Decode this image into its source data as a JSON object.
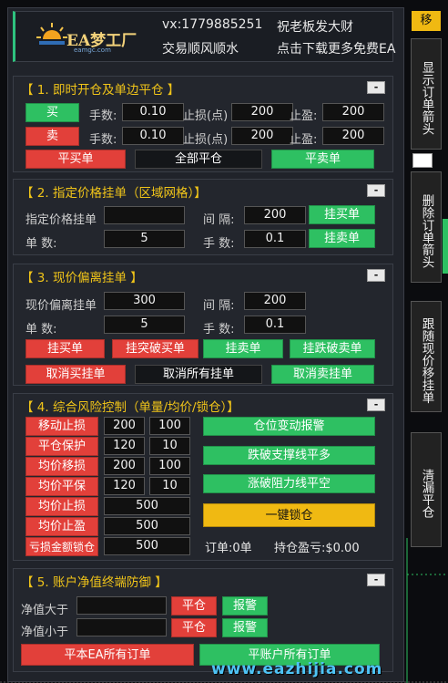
{
  "header": {
    "logo_text": "EA梦工厂",
    "logo_sub": "eamgc.com",
    "contact": "vx:1779885251",
    "wish1": "祝老板发大财",
    "wish2": "交易顺风顺水",
    "download": "点击下载更多免费EA"
  },
  "side": {
    "move": "移",
    "show_arrows": "显示订单箭头",
    "delete_arrows": "删除订单箭头",
    "trailing": "跟随现价移挂单",
    "clear": "清漏平仓"
  },
  "s1": {
    "title": "【 1. 即时开仓及单边平仓 】",
    "collapse": "-",
    "buy": "买",
    "sell": "卖",
    "lots_label": "手数:",
    "sl_label": "止损(点)",
    "tp_label": "止盈:",
    "buy_lots": "0.10",
    "buy_sl": "200",
    "buy_tp": "200",
    "sell_lots": "0.10",
    "sell_sl": "200",
    "sell_tp": "200",
    "close_buy": "平买单",
    "close_all": "全部平仓",
    "close_sell": "平卖单"
  },
  "s2": {
    "title": "【 2. 指定价格挂单（区域网格）】",
    "collapse": "-",
    "price_label": "指定价格挂单",
    "price_value": "",
    "interval_label": "间 隔:",
    "interval_value": "200",
    "count_label": "单    数:",
    "count_value": "5",
    "lots_label": "手 数:",
    "lots_value": "0.1",
    "buy_limit": "挂买单",
    "sell_limit": "挂卖单"
  },
  "s3": {
    "title": "【 3. 现价偏离挂单 】",
    "collapse": "-",
    "offset_label": "现价偏离挂单",
    "offset_value": "300",
    "interval_label": "间 隔:",
    "interval_value": "200",
    "count_label": "单    数:",
    "count_value": "5",
    "lots_label": "手 数:",
    "lots_value": "0.1",
    "buy_limit": "挂买单",
    "buy_stop": "挂突破买单",
    "sell_limit": "挂卖单",
    "sell_stop": "挂跌破卖单",
    "cancel_buy": "取消买挂单",
    "cancel_all": "取消所有挂单",
    "cancel_sell": "取消卖挂单"
  },
  "s4": {
    "title": "【 4. 综合风险控制（单量/均价/锁仓）】",
    "collapse": "-",
    "rows": [
      {
        "label": "移动止损",
        "v1": "200",
        "v2": "100"
      },
      {
        "label": "平仓保护",
        "v1": "120",
        "v2": "10"
      },
      {
        "label": "均价移损",
        "v1": "200",
        "v2": "100"
      },
      {
        "label": "均价平保",
        "v1": "120",
        "v2": "10"
      },
      {
        "label": "均价止损",
        "v1": "500",
        "v2": ""
      },
      {
        "label": "均价止盈",
        "v1": "500",
        "v2": ""
      },
      {
        "label": "亏损金额锁仓",
        "v1": "500",
        "v2": ""
      }
    ],
    "alert_btn": "仓位变动报警",
    "break_support": "跌破支撑线平多",
    "break_resist": "涨破阻力线平空",
    "lock": "一键锁仓",
    "orders_label": "订单:0单",
    "pnl_label": "持仓盈亏:$0.00"
  },
  "s5": {
    "title": "【 5. 账户净值终端防御 】",
    "collapse": "-",
    "above_label": "净值大于",
    "below_label": "净值小于",
    "above_value": "",
    "below_value": "",
    "close": "平仓",
    "alarm": "报警",
    "close_ea": "平本EA所有订单",
    "close_account": "平账户所有订单"
  },
  "watermark": "www.eazhijia.com",
  "colors": {
    "accent": "#f0c419",
    "red": "#e2403a",
    "green": "#2ec062",
    "panel": "#23262d"
  }
}
